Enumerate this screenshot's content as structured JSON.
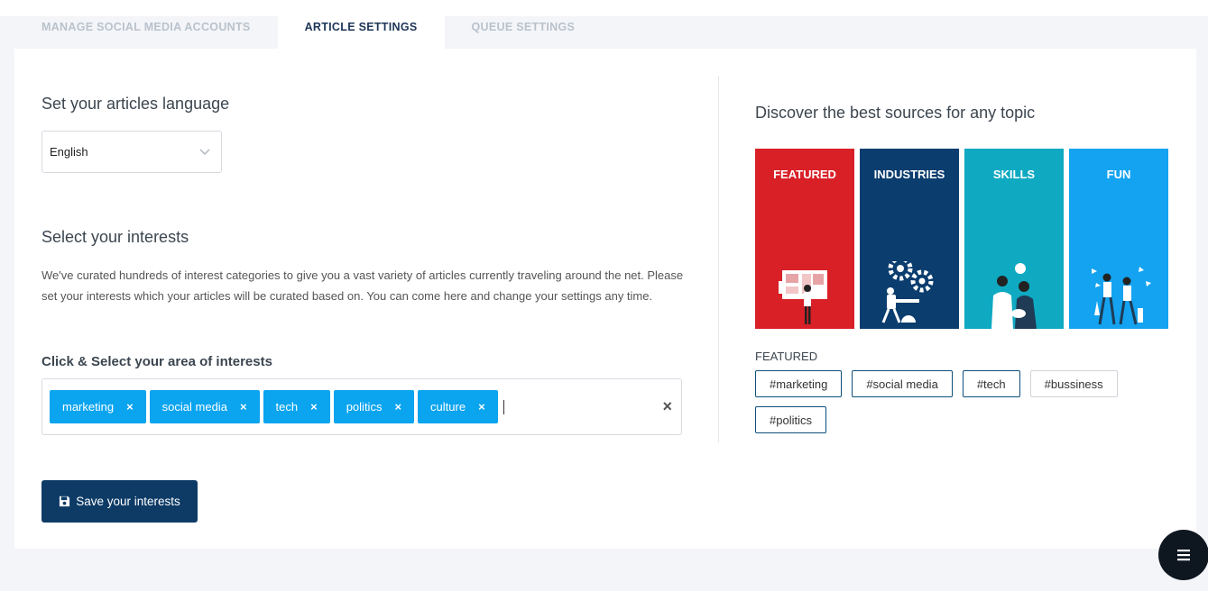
{
  "tabs": [
    {
      "label": "MANAGE SOCIAL MEDIA ACCOUNTS",
      "active": false
    },
    {
      "label": "ARTICLE SETTINGS",
      "active": true
    },
    {
      "label": "QUEUE SETTINGS",
      "active": false
    }
  ],
  "language": {
    "heading": "Set your articles language",
    "selected": "English"
  },
  "interests": {
    "heading": "Select your interests",
    "description": "We've curated hundreds of interest categories to give you a vast variety of articles currently traveling around the net. Please set your interests which your articles will be curated based on. You can come here and change your settings any time.",
    "select_label": "Click & Select your area of interests",
    "chips": [
      {
        "label": "marketing",
        "remove": "×"
      },
      {
        "label": "social media",
        "remove": "×"
      },
      {
        "label": "tech",
        "remove": "×"
      },
      {
        "label": "politics",
        "remove": "×"
      },
      {
        "label": "culture",
        "remove": "×"
      }
    ],
    "clear_all": "×",
    "save_label": "Save your interests"
  },
  "discover": {
    "heading": "Discover the best sources for any topic",
    "tiles": [
      {
        "label": "FEATURED",
        "color": "#d92027",
        "icon": "presentation-board-illustration"
      },
      {
        "label": "INDUSTRIES",
        "color": "#0b3d6e",
        "icon": "gears-illustration"
      },
      {
        "label": "SKILLS",
        "color": "#0fa9c2",
        "icon": "team-working-illustration"
      },
      {
        "label": "FUN",
        "color": "#14a3f0",
        "icon": "people-celebrating-illustration"
      }
    ],
    "section_label": "FEATURED",
    "hashtags": [
      {
        "label": "#marketing",
        "highlighted": true
      },
      {
        "label": "#social media",
        "highlighted": true
      },
      {
        "label": "#tech",
        "highlighted": true
      },
      {
        "label": "#bussiness",
        "highlighted": false
      },
      {
        "label": "#politics",
        "highlighted": true
      }
    ]
  },
  "fab": {
    "icon": "menu-icon"
  },
  "colors": {
    "primary": "#0d3b66",
    "chip": "#0aa4ef",
    "page_bg": "#f4f5f8"
  }
}
